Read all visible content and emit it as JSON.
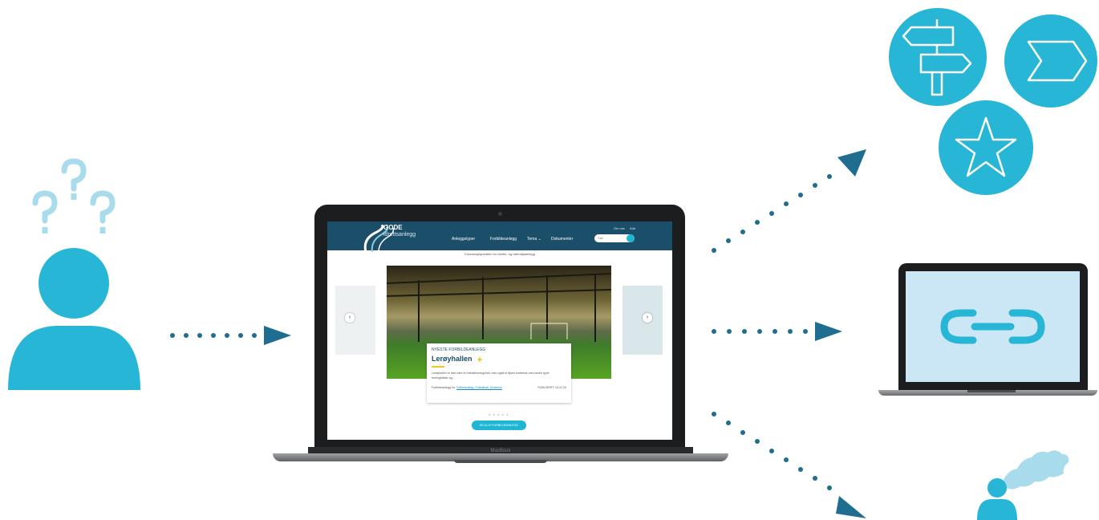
{
  "colors": {
    "accent": "#27b6d6",
    "accent_light": "#a8dcec",
    "dark_navy": "#1b4e68",
    "arrow": "#1f6d91"
  },
  "icons": {
    "person": "person-icon",
    "question_marks": "question-mark-icon",
    "signpost": "signpost-icon",
    "chevron": "chevron-right-icon",
    "star": "star-icon",
    "link": "link-icon",
    "map_person": "map-person-icon"
  },
  "laptop": {
    "brand": "MacBook"
  },
  "site": {
    "logo_title": "GODE",
    "logo_subtitle": "idrettsanlegg",
    "nav": [
      "Anleggstyper",
      "Forbildeanlegg",
      "Tema ⌄",
      "Dokumenter"
    ],
    "top_links": [
      "Om oss",
      "Add"
    ],
    "search_placeholder": "Søk",
    "tagline": "Kunnskapsportalen for idretts- og nærmiljøanlegg",
    "card": {
      "kicker": "NYESTE FORBILDEANLEGG",
      "title": "Lerøyhallen",
      "text": "Lerøyhallen er ikke bare en fotballtreningshall, men også et åpent klubbhus med andre typer treningsflater og...",
      "meta_label": "Forbildeanlegg for:",
      "meta_links": "Fotballanlegg, Fotballhall, Klubbhus",
      "date": "PUBLISERT: 10.12.20"
    },
    "carousel_dots": "● ● ● ● ●",
    "cta": "SE ALLE FORBILDEANLEGG"
  }
}
